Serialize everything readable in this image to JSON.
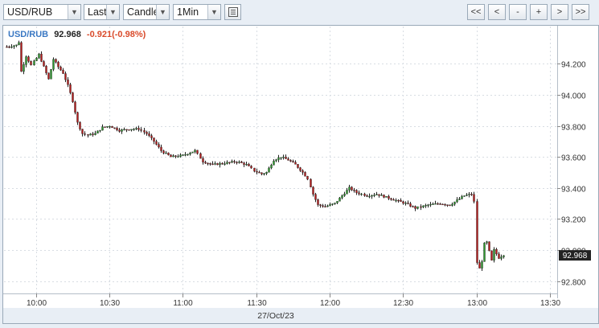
{
  "toolbar": {
    "symbol": "USD/RUB",
    "price_type": "Last",
    "chart_type": "Candle",
    "interval": "1Min",
    "nav_buttons": [
      "<<",
      "<",
      "-",
      "+",
      ">",
      ">>"
    ]
  },
  "header": {
    "symbol": "USD/RUB",
    "last": "92.968",
    "change": "-0.921(-0.98%)"
  },
  "date_label": "27/Oct/23",
  "colors": {
    "up": "#2e9b2e",
    "down": "#b71c1c",
    "symbol": "#3a78c3",
    "change": "#d94a2a",
    "last_box": "#222222"
  },
  "chart_data": {
    "type": "candlestick",
    "title": "USD/RUB",
    "x_ticks": [
      "10:00",
      "10:30",
      "11:00",
      "11:30",
      "12:00",
      "12:30",
      "13:00",
      "13:30"
    ],
    "y_ticks": [
      "94.200",
      "94.000",
      "93.800",
      "93.600",
      "93.400",
      "93.200",
      "93.000",
      "92.800"
    ],
    "ylim": [
      92.72,
      94.44
    ],
    "xlim_minutes": [
      587,
      813
    ],
    "last_value": 92.968,
    "series": [
      {
        "t": 588,
        "c": 94.31
      },
      {
        "t": 592,
        "c": 94.32
      },
      {
        "t": 593,
        "c": 94.34
      },
      {
        "t": 594,
        "c": 94.15
      },
      {
        "t": 596,
        "c": 94.25
      },
      {
        "t": 598,
        "c": 94.19
      },
      {
        "t": 601,
        "c": 94.26
      },
      {
        "t": 603,
        "c": 94.18
      },
      {
        "t": 605,
        "c": 94.1
      },
      {
        "t": 607,
        "c": 94.23
      },
      {
        "t": 609,
        "c": 94.18
      },
      {
        "t": 611,
        "c": 94.14
      },
      {
        "t": 613,
        "c": 94.06
      },
      {
        "t": 615,
        "c": 93.96
      },
      {
        "t": 617,
        "c": 93.82
      },
      {
        "t": 619,
        "c": 93.75
      },
      {
        "t": 621,
        "c": 93.74
      },
      {
        "t": 624,
        "c": 93.75
      },
      {
        "t": 627,
        "c": 93.79
      },
      {
        "t": 630,
        "c": 93.8
      },
      {
        "t": 634,
        "c": 93.77
      },
      {
        "t": 638,
        "c": 93.78
      },
      {
        "t": 642,
        "c": 93.78
      },
      {
        "t": 645,
        "c": 93.75
      },
      {
        "t": 648,
        "c": 93.7
      },
      {
        "t": 651,
        "c": 93.64
      },
      {
        "t": 655,
        "c": 93.6
      },
      {
        "t": 660,
        "c": 93.61
      },
      {
        "t": 665,
        "c": 93.64
      },
      {
        "t": 668,
        "c": 93.57
      },
      {
        "t": 672,
        "c": 93.55
      },
      {
        "t": 677,
        "c": 93.56
      },
      {
        "t": 682,
        "c": 93.57
      },
      {
        "t": 686,
        "c": 93.55
      },
      {
        "t": 689,
        "c": 93.51
      },
      {
        "t": 692,
        "c": 93.49
      },
      {
        "t": 694,
        "c": 93.5
      },
      {
        "t": 697,
        "c": 93.58
      },
      {
        "t": 700,
        "c": 93.6
      },
      {
        "t": 703,
        "c": 93.58
      },
      {
        "t": 706,
        "c": 93.55
      },
      {
        "t": 709,
        "c": 93.5
      },
      {
        "t": 711,
        "c": 93.46
      },
      {
        "t": 713,
        "c": 93.36
      },
      {
        "t": 715,
        "c": 93.29
      },
      {
        "t": 718,
        "c": 93.28
      },
      {
        "t": 722,
        "c": 93.3
      },
      {
        "t": 725,
        "c": 93.35
      },
      {
        "t": 728,
        "c": 93.4
      },
      {
        "t": 731,
        "c": 93.37
      },
      {
        "t": 735,
        "c": 93.35
      },
      {
        "t": 739,
        "c": 93.36
      },
      {
        "t": 743,
        "c": 93.34
      },
      {
        "t": 747,
        "c": 93.32
      },
      {
        "t": 751,
        "c": 93.3
      },
      {
        "t": 755,
        "c": 93.27
      },
      {
        "t": 760,
        "c": 93.29
      },
      {
        "t": 765,
        "c": 93.3
      },
      {
        "t": 769,
        "c": 93.29
      },
      {
        "t": 772,
        "c": 93.32
      },
      {
        "t": 775,
        "c": 93.35
      },
      {
        "t": 778,
        "c": 93.36
      },
      {
        "t": 779,
        "c": 93.31
      },
      {
        "t": 780,
        "c": 92.92
      },
      {
        "t": 781,
        "c": 92.88
      },
      {
        "t": 782,
        "c": 92.93
      },
      {
        "t": 783,
        "c": 93.04
      },
      {
        "t": 784,
        "c": 93.05
      },
      {
        "t": 785,
        "c": 92.99
      },
      {
        "t": 786,
        "c": 92.93
      },
      {
        "t": 787,
        "c": 93.0
      },
      {
        "t": 789,
        "c": 92.95
      },
      {
        "t": 791,
        "c": 92.97
      }
    ]
  }
}
